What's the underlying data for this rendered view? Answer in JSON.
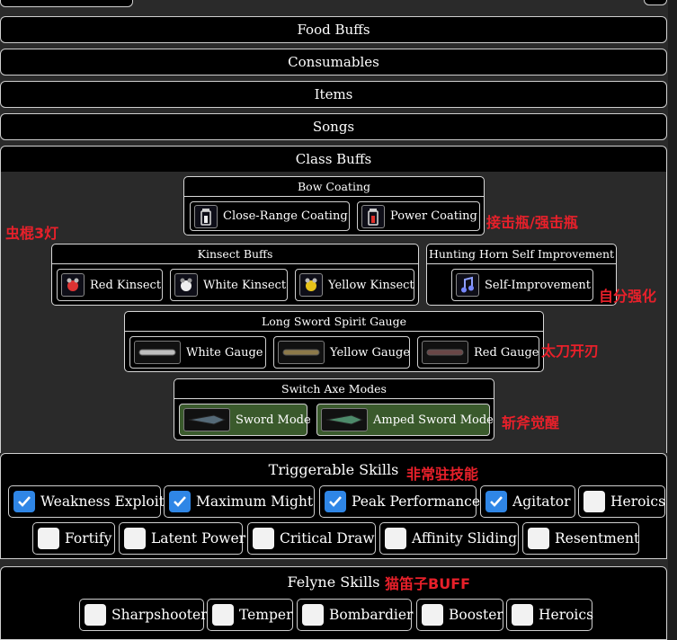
{
  "sections": {
    "food_buffs": "Food Buffs",
    "consumables": "Consumables",
    "items": "Items",
    "songs": "Songs",
    "class_buffs": "Class Buffs"
  },
  "class_buffs": {
    "bow_coating": {
      "title": "Bow Coating",
      "buttons": [
        "Close-Range Coating",
        "Power Coating"
      ]
    },
    "kinsect": {
      "title": "Kinsect Buffs",
      "buttons": [
        "Red Kinsect",
        "White Kinsect",
        "Yellow Kinsect"
      ]
    },
    "hunting_horn": {
      "title": "Hunting Horn Self Improvement",
      "buttons": [
        "Self-Improvement"
      ]
    },
    "long_sword": {
      "title": "Long Sword Spirit Gauge",
      "buttons": [
        "White Gauge",
        "Yellow Gauge",
        "Red Gauge"
      ]
    },
    "switch_axe": {
      "title": "Switch Axe Modes",
      "buttons": [
        "Sword Mode",
        "Amped Sword Mode"
      ]
    }
  },
  "annotations": {
    "bow": "接击瓶/强击瓶",
    "kinsect": "虫棍3灯",
    "horn": "自分强化",
    "long_sword": "太刀开刃",
    "switch_axe": "斩斧觉醒",
    "triggerable": "非常驻技能",
    "felyne": "猫笛子BUFF"
  },
  "triggerable": {
    "title": "Triggerable Skills",
    "skills": [
      {
        "label": "Weakness Exploit",
        "checked": true
      },
      {
        "label": "Maximum Might",
        "checked": true
      },
      {
        "label": "Peak Performance",
        "checked": true
      },
      {
        "label": "Agitator",
        "checked": true
      },
      {
        "label": "Heroics",
        "checked": false
      },
      {
        "label": "Fortify",
        "checked": false
      },
      {
        "label": "Latent Power",
        "checked": false
      },
      {
        "label": "Critical Draw",
        "checked": false
      },
      {
        "label": "Affinity Sliding",
        "checked": false
      },
      {
        "label": "Resentment",
        "checked": false
      }
    ]
  },
  "felyne": {
    "title": "Felyne Skills",
    "skills": [
      {
        "label": "Sharpshooter",
        "checked": false
      },
      {
        "label": "Temper",
        "checked": false
      },
      {
        "label": "Bombardier",
        "checked": false
      },
      {
        "label": "Booster",
        "checked": false
      },
      {
        "label": "Heroics",
        "checked": false
      }
    ]
  },
  "colors": {
    "checkbox_on": "#2f86e6",
    "annotation_red": "#e8202a",
    "switch_axe_green": "#3a5a2c"
  }
}
